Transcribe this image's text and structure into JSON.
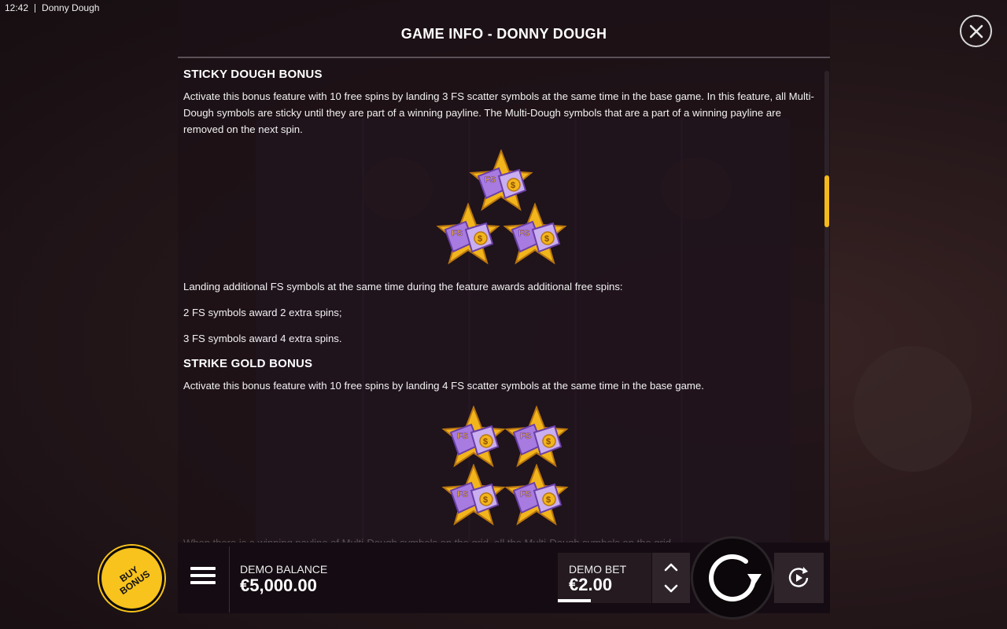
{
  "status": {
    "time": "12:42",
    "app_name": "Donny Dough"
  },
  "panel": {
    "title": "GAME INFO - DONNY DOUGH",
    "sections": [
      {
        "heading": "STICKY DOUGH BONUS",
        "text": "Activate this bonus feature with 10 free spins by landing 3 FS scatter symbols at the same time in the base game. In this feature, all Multi-Dough symbols are sticky until they are part of a winning payline. The Multi-Dough symbols that are a part of a winning payline are removed on the next spin."
      },
      {
        "lines": [
          "Landing additional FS symbols at the same time during the feature awards additional free spins:",
          "2 FS symbols award 2 extra spins;",
          "3 FS symbols award 4 extra spins."
        ]
      },
      {
        "heading": "STRIKE GOLD BONUS",
        "text": "Activate this bonus feature with 10 free spins by landing 4 FS scatter symbols at the same time in the base game."
      }
    ],
    "symbol_label": "FS",
    "faded_text": "When there is a winning payline of Multi-Dough symbols on the grid, all the Multi-Dough symbols on the grid"
  },
  "controls": {
    "buy_bonus": "BUY BONUS",
    "balance_label": "DEMO BALANCE",
    "balance_value": "€5,000.00",
    "bet_label": "DEMO BET",
    "bet_value": "€2.00"
  },
  "colors": {
    "accent": "#f5b91b",
    "symbol_purple": "#a77be0",
    "symbol_gold": "#f2b51c"
  }
}
